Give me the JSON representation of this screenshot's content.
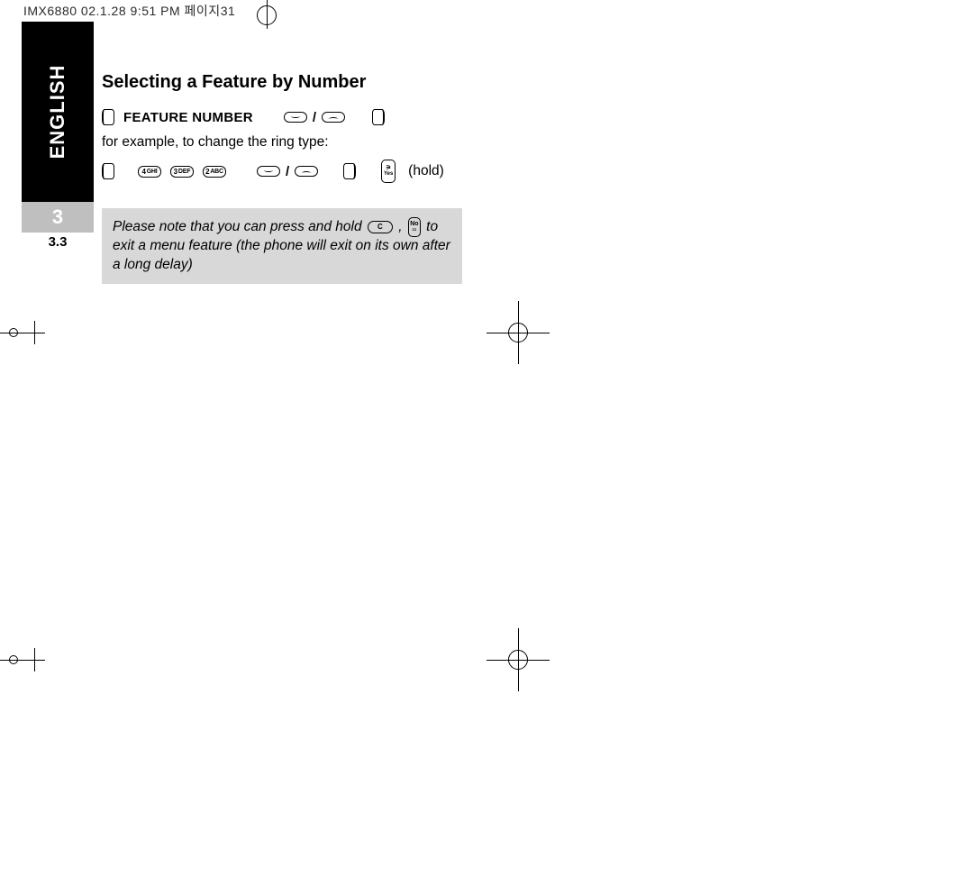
{
  "print_header": "IMX6880 02.1.28 9:51 PM   페이지31",
  "sidebar": {
    "language": "ENGLISH",
    "chapter": "3",
    "section": "3.3"
  },
  "content": {
    "heading": "Selecting a Feature by Number",
    "feature_label": "FEATURE NUMBER",
    "example_intro": "for example, to change the ring type:",
    "hold_label": "(hold)",
    "keys": {
      "k4": "4 GHI",
      "k3": "3 DEF",
      "k2": "2 ABC",
      "yes": "Yes",
      "no_top": "No",
      "c": "C"
    },
    "note_pre": "Please note that you can press and hold ",
    "note_mid": " , ",
    "note_post": " to exit a menu feature (the phone will exit on its own after a long delay)"
  }
}
